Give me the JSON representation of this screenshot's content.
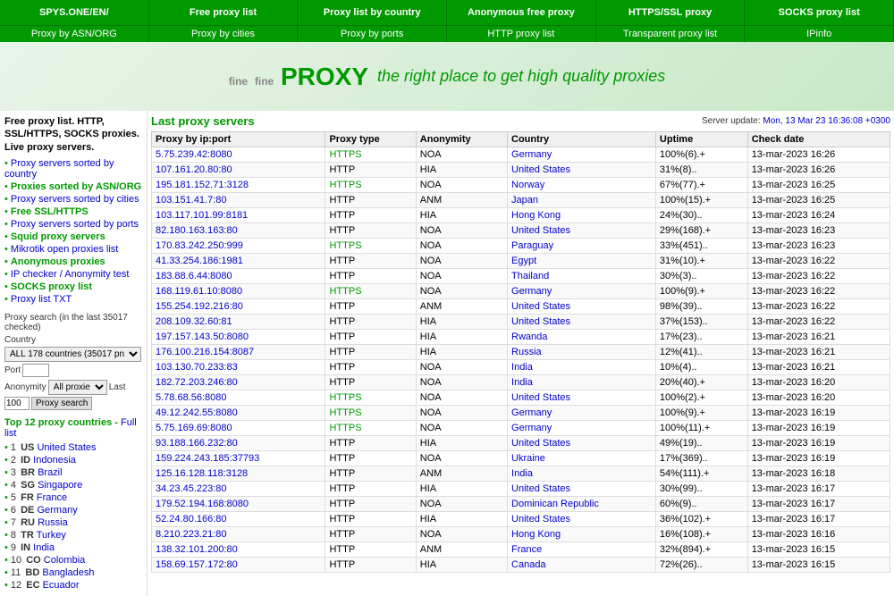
{
  "nav": {
    "top": [
      {
        "label": "SPYS.ONE/EN/",
        "url": "#"
      },
      {
        "label": "Free proxy list",
        "url": "#"
      },
      {
        "label": "Proxy list by country",
        "url": "#"
      },
      {
        "label": "Anonymous free proxy",
        "url": "#"
      },
      {
        "label": "HTTPS/SSL proxy",
        "url": "#"
      },
      {
        "label": "SOCKS proxy list",
        "url": "#"
      }
    ],
    "second": [
      {
        "label": "Proxy by ASN/ORG",
        "url": "#"
      },
      {
        "label": "Proxy by cities",
        "url": "#"
      },
      {
        "label": "Proxy by ports",
        "url": "#"
      },
      {
        "label": "HTTP proxy list",
        "url": "#"
      },
      {
        "label": "Transparent proxy list",
        "url": "#"
      },
      {
        "label": "IPinfo",
        "url": "#"
      }
    ]
  },
  "banner": {
    "fine_small": "fine",
    "proxy_brand": "PROXY",
    "tagline": "the right place to get high quality proxies"
  },
  "sidebar": {
    "title": "Free proxy list. HTTP, SSL/HTTPS, SOCKS proxies. Live proxy servers.",
    "links": [
      {
        "text": "Proxy servers sorted by country",
        "green": false
      },
      {
        "text": "Proxies sorted by ASN/ORG",
        "green": true
      },
      {
        "text": "Proxy servers sorted by cities",
        "green": false
      },
      {
        "text": "Free SSL/HTTPS",
        "green": true
      },
      {
        "text": "Proxy servers sorted by ports",
        "green": false
      },
      {
        "text": "Squid proxy servers",
        "green": true
      },
      {
        "text": "Mikrotik open proxies list",
        "green": false
      },
      {
        "text": "Anonymous proxies",
        "green": true
      },
      {
        "text": "IP checker / Anonymity test",
        "green": false
      },
      {
        "text": "SOCKS proxy list",
        "green": true
      },
      {
        "text": "Proxy list TXT",
        "green": false
      }
    ],
    "proxy_search": {
      "label": "Proxy search (in the last 35017 checked)",
      "country_label": "Country",
      "country_value": "ALL 178 countries (35017 pn",
      "port_label": "Port",
      "anonymity_label": "Anonymity",
      "anonymity_value": "All proxie",
      "last_label": "Last",
      "last_value": "100",
      "search_button": "Proxy search"
    },
    "top_countries": {
      "title": "Top 12 proxy countries",
      "full_list_label": "Full list",
      "countries": [
        {
          "num": 1,
          "code": "US",
          "name": "United States"
        },
        {
          "num": 2,
          "code": "ID",
          "name": "Indonesia"
        },
        {
          "num": 3,
          "code": "BR",
          "name": "Brazil"
        },
        {
          "num": 4,
          "code": "SG",
          "name": "Singapore"
        },
        {
          "num": 5,
          "code": "FR",
          "name": "France"
        },
        {
          "num": 6,
          "code": "DE",
          "name": "Germany"
        },
        {
          "num": 7,
          "code": "RU",
          "name": "Russia"
        },
        {
          "num": 8,
          "code": "TR",
          "name": "Turkey"
        },
        {
          "num": 9,
          "code": "IN",
          "name": "India"
        },
        {
          "num": 10,
          "code": "CO",
          "name": "Colombia"
        },
        {
          "num": 11,
          "code": "BD",
          "name": "Bangladesh"
        },
        {
          "num": 12,
          "code": "EC",
          "name": "Ecuador"
        }
      ]
    }
  },
  "content": {
    "section_title": "Last proxy servers",
    "server_update": "Server update:",
    "server_update_date": "Mon, 13 Mar 23 16:36:08 +0300",
    "table_headers": [
      "Proxy by ip:port",
      "Proxy type",
      "Anonymity",
      "Country",
      "Uptime",
      "Check date"
    ],
    "rows": [
      {
        "ip": "5.75.239.42:8080",
        "type": "HTTPS",
        "anon": "NOA",
        "country": "Germany",
        "uptime": "100%(6).+",
        "date": "13-mar-2023 16:26"
      },
      {
        "ip": "107.161.20.80:80",
        "type": "HTTP",
        "anon": "HIA",
        "country": "United States",
        "uptime": "31%(8)..",
        "date": "13-mar-2023 16:26"
      },
      {
        "ip": "195.181.152.71:3128",
        "type": "HTTPS",
        "anon": "NOA",
        "country": "Norway",
        "uptime": "67%(77).+",
        "date": "13-mar-2023 16:25"
      },
      {
        "ip": "103.151.41.7:80",
        "type": "HTTP",
        "anon": "ANM",
        "country": "Japan",
        "uptime": "100%(15).+",
        "date": "13-mar-2023 16:25"
      },
      {
        "ip": "103.117.101.99:8181",
        "type": "HTTP",
        "anon": "HIA",
        "country": "Hong Kong",
        "uptime": "24%(30)..",
        "date": "13-mar-2023 16:24"
      },
      {
        "ip": "82.180.163.163:80",
        "type": "HTTP",
        "anon": "NOA",
        "country": "United States",
        "uptime": "29%(168).+",
        "date": "13-mar-2023 16:23"
      },
      {
        "ip": "170.83.242.250:999",
        "type": "HTTPS",
        "anon": "NOA",
        "country": "Paraguay",
        "uptime": "33%(451)..",
        "date": "13-mar-2023 16:23"
      },
      {
        "ip": "41.33.254.186:1981",
        "type": "HTTP",
        "anon": "NOA",
        "country": "Egypt",
        "uptime": "31%(10).+",
        "date": "13-mar-2023 16:22"
      },
      {
        "ip": "183.88.6.44:8080",
        "type": "HTTP",
        "anon": "NOA",
        "country": "Thailand",
        "uptime": "30%(3)..",
        "date": "13-mar-2023 16:22"
      },
      {
        "ip": "168.119.61.10:8080",
        "type": "HTTPS",
        "anon": "NOA",
        "country": "Germany",
        "uptime": "100%(9).+",
        "date": "13-mar-2023 16:22"
      },
      {
        "ip": "155.254.192.216:80",
        "type": "HTTP",
        "anon": "ANM",
        "country": "United States",
        "uptime": "98%(39)..",
        "date": "13-mar-2023 16:22"
      },
      {
        "ip": "208.109.32.60:81",
        "type": "HTTP",
        "anon": "HIA",
        "country": "United States",
        "uptime": "37%(153)..",
        "date": "13-mar-2023 16:22"
      },
      {
        "ip": "197.157.143.50:8080",
        "type": "HTTP",
        "anon": "HIA",
        "country": "Rwanda",
        "uptime": "17%(23)..",
        "date": "13-mar-2023 16:21"
      },
      {
        "ip": "176.100.216.154:8087",
        "type": "HTTP",
        "anon": "HIA",
        "country": "Russia",
        "uptime": "12%(41)..",
        "date": "13-mar-2023 16:21"
      },
      {
        "ip": "103.130.70.233:83",
        "type": "HTTP",
        "anon": "NOA",
        "country": "India",
        "uptime": "10%(4)..",
        "date": "13-mar-2023 16:21"
      },
      {
        "ip": "182.72.203.246:80",
        "type": "HTTP",
        "anon": "NOA",
        "country": "India",
        "uptime": "20%(40).+",
        "date": "13-mar-2023 16:20"
      },
      {
        "ip": "5.78.68.56:8080",
        "type": "HTTPS",
        "anon": "NOA",
        "country": "United States",
        "uptime": "100%(2).+",
        "date": "13-mar-2023 16:20"
      },
      {
        "ip": "49.12.242.55:8080",
        "type": "HTTPS",
        "anon": "NOA",
        "country": "Germany",
        "uptime": "100%(9).+",
        "date": "13-mar-2023 16:19"
      },
      {
        "ip": "5.75.169.69:8080",
        "type": "HTTPS",
        "anon": "NOA",
        "country": "Germany",
        "uptime": "100%(11).+",
        "date": "13-mar-2023 16:19"
      },
      {
        "ip": "93.188.166.232:80",
        "type": "HTTP",
        "anon": "HIA",
        "country": "United States",
        "uptime": "49%(19)..",
        "date": "13-mar-2023 16:19"
      },
      {
        "ip": "159.224.243.185:37793",
        "type": "HTTP",
        "anon": "NOA",
        "country": "Ukraine",
        "uptime": "17%(369)..",
        "date": "13-mar-2023 16:19"
      },
      {
        "ip": "125.16.128.118:3128",
        "type": "HTTP",
        "anon": "ANM",
        "country": "India",
        "uptime": "54%(111).+",
        "date": "13-mar-2023 16:18"
      },
      {
        "ip": "34.23.45.223:80",
        "type": "HTTP",
        "anon": "HIA",
        "country": "United States",
        "uptime": "30%(99)..",
        "date": "13-mar-2023 16:17"
      },
      {
        "ip": "179.52.194.168:8080",
        "type": "HTTP",
        "anon": "NOA",
        "country": "Dominican Republic",
        "uptime": "60%(9)..",
        "date": "13-mar-2023 16:17"
      },
      {
        "ip": "52.24.80.166:80",
        "type": "HTTP",
        "anon": "HIA",
        "country": "United States",
        "uptime": "36%(102).+",
        "date": "13-mar-2023 16:17"
      },
      {
        "ip": "8.210.223.21:80",
        "type": "HTTP",
        "anon": "NOA",
        "country": "Hong Kong",
        "uptime": "16%(108).+",
        "date": "13-mar-2023 16:16"
      },
      {
        "ip": "138.32.101.200:80",
        "type": "HTTP",
        "anon": "ANM",
        "country": "France",
        "uptime": "32%(894).+",
        "date": "13-mar-2023 16:15"
      },
      {
        "ip": "158.69.157.172:80",
        "type": "HTTP",
        "anon": "HIA",
        "country": "Canada",
        "uptime": "72%(26)..",
        "date": "13-mar-2023 16:15"
      }
    ]
  }
}
